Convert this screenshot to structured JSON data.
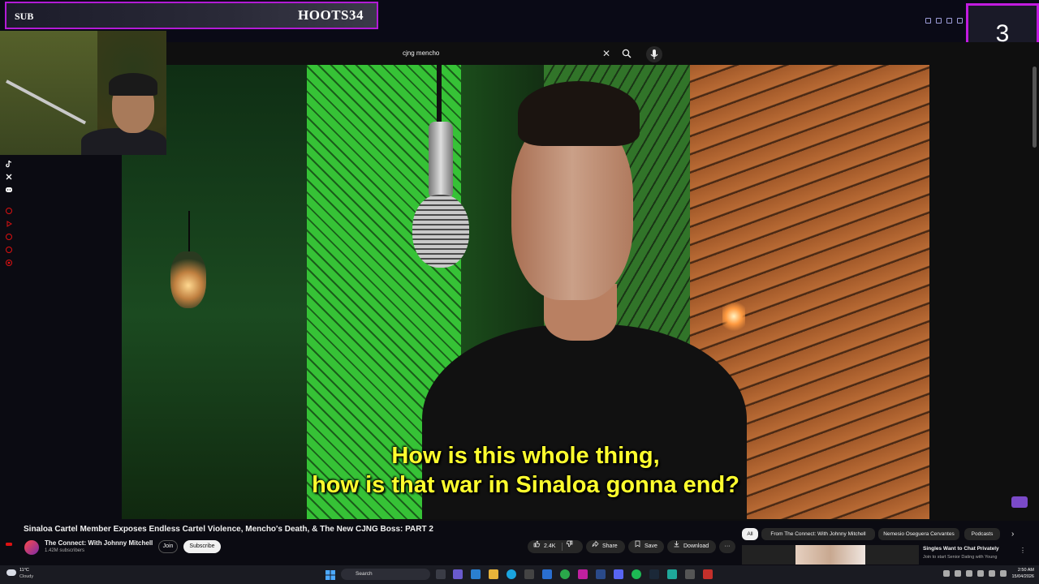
{
  "overlay": {
    "sub_label": "SUB",
    "streamer_name": "HOOTS34",
    "counter": "3",
    "accent_color": "#c21be0"
  },
  "social_icons": [
    "tiktok-icon",
    "x-icon",
    "discord-icon"
  ],
  "search": {
    "query": "cjng mencho",
    "clear_icon": "✕"
  },
  "video": {
    "subtitle_line1": "How is this whole thing,",
    "subtitle_line2": "how is that war in Sinaloa gonna end?",
    "title": "Sinaloa Cartel Member Exposes Endless Cartel Violence, Mencho's Death, & The New CJNG Boss: PART 2"
  },
  "channel": {
    "name": "The Connect: With Johnny Mitchell",
    "subscribers": "1.42M subscribers",
    "join_label": "Join",
    "subscribe_label": "Subscribe"
  },
  "actions": {
    "likes": "2.4K",
    "share_label": "Share",
    "save_label": "Save",
    "download_label": "Download",
    "more_label": "···"
  },
  "chips": [
    "All",
    "From The Connect: With Johnny Mitchell",
    "Nemesio Oseguera Cervantes",
    "Podcasts"
  ],
  "recommendation": {
    "title": "Singles Want to Chat Privately",
    "desc": "Join to start Senior Dating with Young"
  },
  "taskbar": {
    "temperature": "11°C",
    "weather": "Cloudy",
    "search_label": "Search",
    "time": "2:50 AM",
    "date": "15/04/2026"
  }
}
